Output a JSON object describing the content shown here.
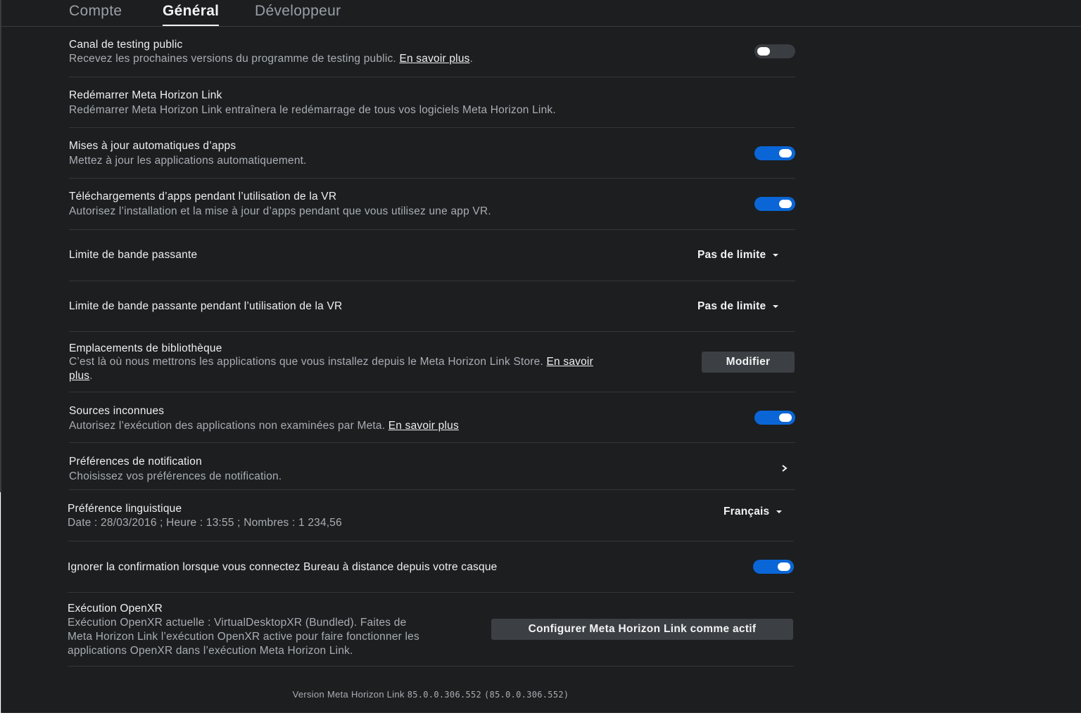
{
  "tabs": [
    {
      "label": "Compte",
      "active": false
    },
    {
      "label": "Général",
      "active": true
    },
    {
      "label": "Développeur",
      "active": false
    }
  ],
  "settings": {
    "public_testing": {
      "title": "Canal de testing public",
      "desc": "Recevez les prochaines versions du programme de testing public.",
      "link": "En savoir plus",
      "toggle": "off"
    },
    "restart": {
      "title": "Redémarrer Meta Horizon Link",
      "desc": "Redémarrer Meta Horizon Link entraînera le redémarrage de tous vos logiciels Meta Horizon Link."
    },
    "auto_updates": {
      "title": "Mises à jour automatiques d’apps",
      "desc": "Mettez à jour les applications automatiquement.",
      "toggle": "on"
    },
    "vr_downloads": {
      "title": "Téléchargements d’apps pendant l’utilisation de la VR",
      "desc": "Autorisez l’installation et la mise à jour d’apps pendant que vous utilisez une app VR.",
      "toggle": "on"
    },
    "bandwidth": {
      "title": "Limite de bande passante",
      "value": "Pas de limite"
    },
    "bandwidth_vr": {
      "title": "Limite de bande passante pendant l’utilisation de la VR",
      "value": "Pas de limite"
    },
    "library": {
      "title": "Emplacements de bibliothèque",
      "desc": "C’est là où nous mettrons les applications que vous installez depuis le Meta Horizon Link Store.",
      "link_part1": "En savoir",
      "link_part2": "plus",
      "button": "Modifier"
    },
    "unknown_sources": {
      "title": "Sources inconnues",
      "desc": "Autorisez l’exécution des applications non examinées par Meta.",
      "link": "En savoir plus",
      "toggle": "on"
    },
    "notifications": {
      "title": "Préférences de notification",
      "desc": "Choisissez vos préférences de notification."
    },
    "language": {
      "title": "Préférence linguistique",
      "desc": "Date : 28/03/2016 ; Heure : 13:55 ; Nombres : 1 234,56",
      "value": "Français"
    },
    "remote_desktop": {
      "title": "Ignorer la confirmation lorsque vous connectez Bureau à distance depuis votre casque",
      "toggle": "on"
    },
    "openxr": {
      "title": "Exécution OpenXR",
      "desc_line1": "Exécution OpenXR actuelle : VirtualDesktopXR (Bundled). Faites de",
      "desc_line2": "Meta Horizon Link l’exécution OpenXR active pour faire fonctionner les",
      "desc_line3": "applications OpenXR dans l’exécution Meta Horizon Link.",
      "button": "Configurer Meta Horizon Link comme actif"
    }
  },
  "footer": {
    "prefix": "Version Meta Horizon Link ",
    "version": "85.0.0.306.552",
    "version_paren": "(85.0.0.306.552)"
  },
  "colors": {
    "background": "#1c1e20",
    "toggle_on": "#0a66d6",
    "toggle_off": "#3a3d41",
    "button": "#3c3f43"
  }
}
